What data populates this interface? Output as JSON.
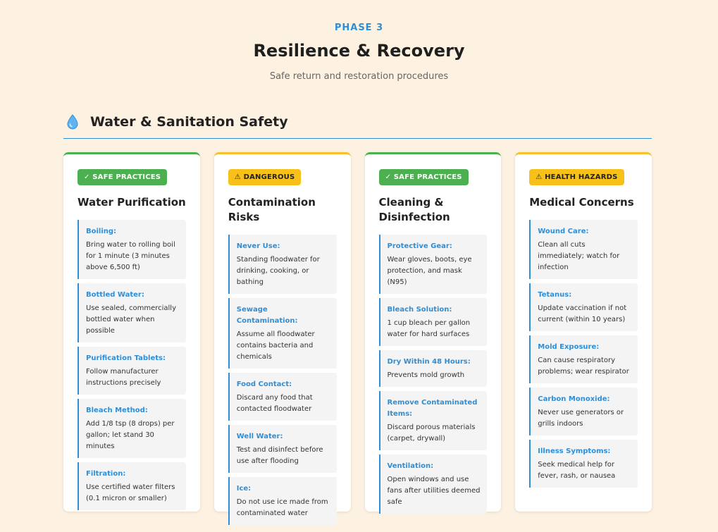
{
  "header": {
    "phase": "PHASE 3",
    "title": "Resilience & Recovery",
    "subtitle": "Safe return and restoration procedures"
  },
  "section": {
    "icon": "water-drop-icon",
    "title": "Water & Sanitation Safety"
  },
  "colors": {
    "accent": "#2f8ed6",
    "safe": "#4caf50",
    "warning": "#f7c11a",
    "background": "#fdf2e1"
  },
  "cards": [
    {
      "badge": "✓ SAFE PRACTICES",
      "title": "Water Purification",
      "items": [
        {
          "title": "Boiling:",
          "text": "Bring water to rolling boil for 1 minute (3 minutes above 6,500 ft)"
        },
        {
          "title": "Bottled Water:",
          "text": "Use sealed, commercially bottled water when possible"
        },
        {
          "title": "Purification Tablets:",
          "text": "Follow manufacturer instructions precisely"
        },
        {
          "title": "Bleach Method:",
          "text": "Add 1/8 tsp (8 drops) per gallon; let stand 30 minutes"
        },
        {
          "title": "Filtration:",
          "text": "Use certified water filters (0.1 micron or smaller)"
        }
      ]
    },
    {
      "badge": "⚠ DANGEROUS",
      "title": "Contamination Risks",
      "items": [
        {
          "title": "Never Use:",
          "text": "Standing floodwater for drinking, cooking, or bathing"
        },
        {
          "title": "Sewage Contamination:",
          "text": "Assume all floodwater contains bacteria and chemicals"
        },
        {
          "title": "Food Contact:",
          "text": "Discard any food that contacted floodwater"
        },
        {
          "title": "Well Water:",
          "text": "Test and disinfect before use after flooding"
        },
        {
          "title": "Ice:",
          "text": "Do not use ice made from contaminated water"
        }
      ]
    },
    {
      "badge": "✓ SAFE PRACTICES",
      "title": "Cleaning & Disinfection",
      "items": [
        {
          "title": "Protective Gear:",
          "text": "Wear gloves, boots, eye protection, and mask (N95)"
        },
        {
          "title": "Bleach Solution:",
          "text": "1 cup bleach per gallon water for hard surfaces"
        },
        {
          "title": "Dry Within 48 Hours:",
          "text": "Prevents mold growth"
        },
        {
          "title": "Remove Contaminated Items:",
          "text": "Discard porous materials (carpet, drywall)"
        },
        {
          "title": "Ventilation:",
          "text": "Open windows and use fans after utilities deemed safe"
        }
      ]
    },
    {
      "badge": "⚠ HEALTH HAZARDS",
      "title": "Medical Concerns",
      "items": [
        {
          "title": "Wound Care:",
          "text": "Clean all cuts immediately; watch for infection"
        },
        {
          "title": "Tetanus:",
          "text": "Update vaccination if not current (within 10 years)"
        },
        {
          "title": "Mold Exposure:",
          "text": "Can cause respiratory problems; wear respirator"
        },
        {
          "title": "Carbon Monoxide:",
          "text": "Never use generators or grills indoors"
        },
        {
          "title": "Illness Symptoms:",
          "text": "Seek medical help for fever, rash, or nausea"
        }
      ]
    }
  ]
}
